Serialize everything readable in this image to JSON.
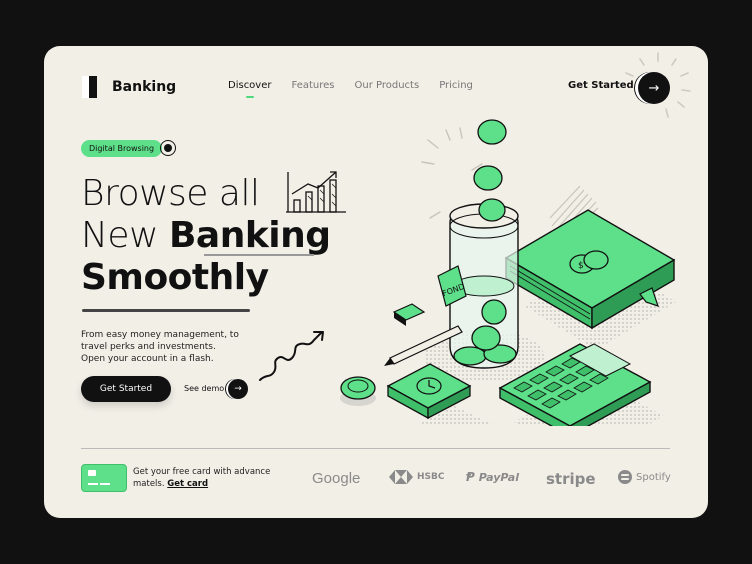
{
  "header": {
    "logo_text": "Banking",
    "nav": [
      {
        "label": "Discover",
        "active": true
      },
      {
        "label": "Features",
        "active": false
      },
      {
        "label": "Our Products",
        "active": false
      },
      {
        "label": "Pricing",
        "active": false
      }
    ],
    "cta_label": "Get Started",
    "cta_icon": "arrow-right-icon"
  },
  "hero": {
    "badge": "Digital Browsing",
    "line1": "Browse all",
    "line2_light": "New ",
    "line2_bold": "Banking",
    "line3": "Smoothly",
    "description": "From easy money management, to travel perks and investments. Open your account in a flash.",
    "primary_button": "Get Started",
    "demo_label": "See demo"
  },
  "illustration": {
    "jar_label": "FOND",
    "coin_symbol": "$"
  },
  "footer": {
    "promo_text": "Get your free card with advance matels.",
    "promo_link": "Get card",
    "brands": [
      "Google",
      "HSBC",
      "PayPal",
      "stripe",
      "Spotify"
    ]
  },
  "colors": {
    "accent": "#5ee08a",
    "background": "#f2efe7",
    "dark": "#111111"
  }
}
